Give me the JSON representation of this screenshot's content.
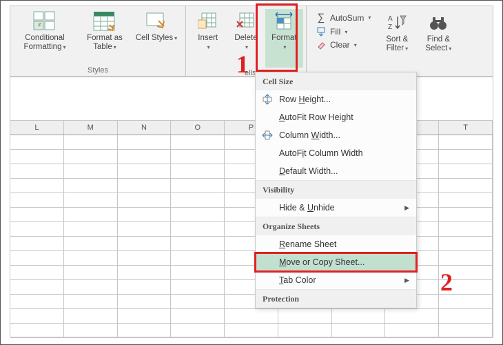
{
  "ribbon": {
    "styles": {
      "conditional": "Conditional Formatting",
      "formatAs": "Format as Table",
      "cellStyles": "Cell Styles",
      "groupLabel": "Styles"
    },
    "cells": {
      "insert": "Insert",
      "delete": "Delete",
      "format": "Format",
      "fragment": "ells"
    },
    "editing": {
      "autosum": "AutoSum",
      "fill": "Fill",
      "clear": "Clear",
      "sortFilter": "Sort & Filter",
      "findSelect": "Find & Select"
    }
  },
  "columns": [
    "L",
    "M",
    "N",
    "O",
    "P",
    "",
    "",
    "",
    "T"
  ],
  "menu": {
    "headers": {
      "cellSize": "Cell Size",
      "visibility": "Visibility",
      "organize": "Organize Sheets",
      "protection": "Protection"
    },
    "items": {
      "rowHeight_pre": "Row ",
      "rowHeight_u": "H",
      "rowHeight_post": "eight...",
      "autofitRow_u": "A",
      "autofitRow_post": "utoFit Row Height",
      "colWidth_pre": "Column ",
      "colWidth_u": "W",
      "colWidth_post": "idth...",
      "autofitCol_pre": "AutoF",
      "autofitCol_u": "i",
      "autofitCol_post": "t Column Width",
      "defaultWidth_u": "D",
      "defaultWidth_post": "efault Width...",
      "hideUnhide_pre": "Hide & ",
      "hideUnhide_u": "U",
      "hideUnhide_post": "nhide",
      "rename_u": "R",
      "rename_post": "ename Sheet",
      "move_u": "M",
      "move_post": "ove or Copy Sheet...",
      "tabColor_u": "T",
      "tabColor_post": "ab Color"
    }
  },
  "annotations": {
    "one": "1",
    "two": "2"
  }
}
